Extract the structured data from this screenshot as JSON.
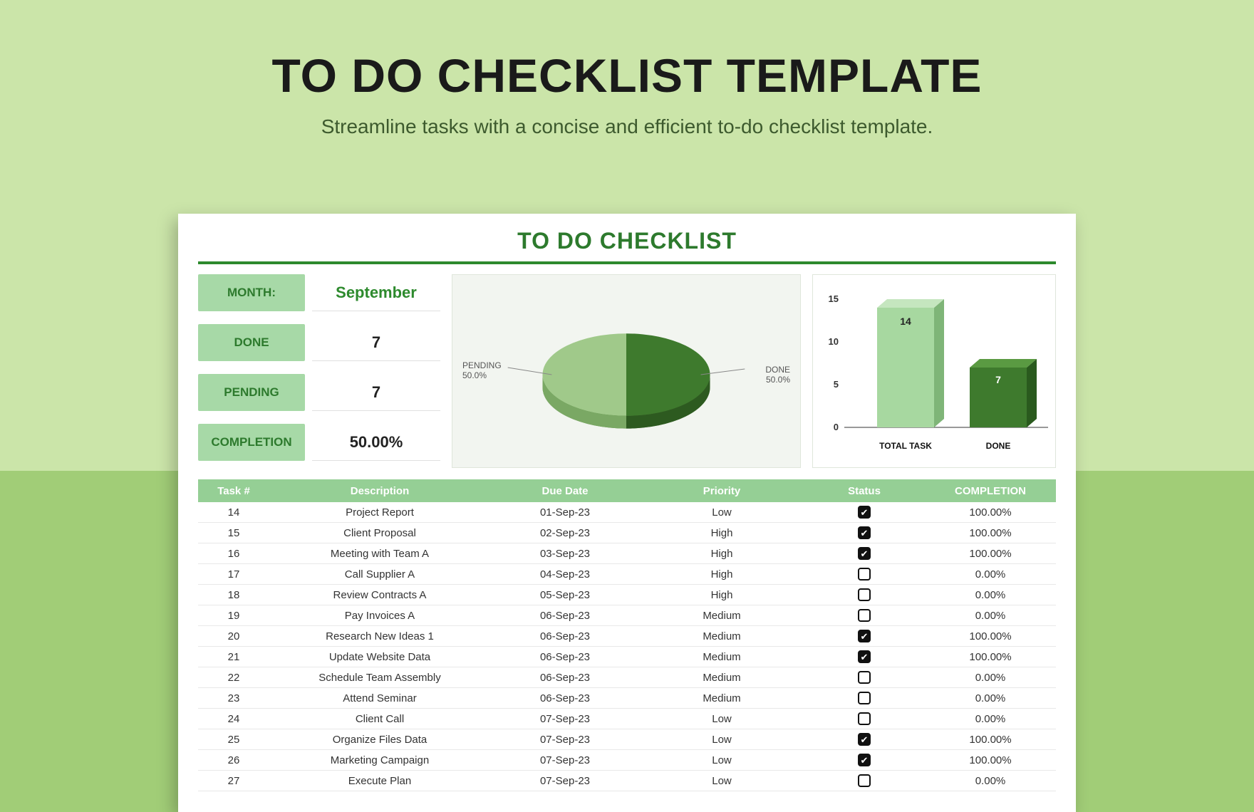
{
  "header": {
    "title": "TO DO CHECKLIST TEMPLATE",
    "subtitle": "Streamline tasks with a concise and efficient to-do checklist template."
  },
  "sheet": {
    "title": "TO DO CHECKLIST",
    "summary": {
      "month_label": "MONTH:",
      "month_value": "September",
      "done_label": "DONE",
      "done_value": "7",
      "pending_label": "PENDING",
      "pending_value": "7",
      "completion_label": "COMPLETION",
      "completion_value": "50.00%"
    },
    "table": {
      "headers": {
        "task": "Task #",
        "desc": "Description",
        "date": "Due Date",
        "prio": "Priority",
        "stat": "Status",
        "comp": "COMPLETION"
      },
      "rows": [
        {
          "task": "14",
          "desc": "Project Report",
          "date": "01-Sep-23",
          "prio": "Low",
          "done": true,
          "comp": "100.00%"
        },
        {
          "task": "15",
          "desc": "Client Proposal",
          "date": "02-Sep-23",
          "prio": "High",
          "done": true,
          "comp": "100.00%"
        },
        {
          "task": "16",
          "desc": "Meeting with Team A",
          "date": "03-Sep-23",
          "prio": "High",
          "done": true,
          "comp": "100.00%"
        },
        {
          "task": "17",
          "desc": "Call Supplier A",
          "date": "04-Sep-23",
          "prio": "High",
          "done": false,
          "comp": "0.00%"
        },
        {
          "task": "18",
          "desc": "Review Contracts A",
          "date": "05-Sep-23",
          "prio": "High",
          "done": false,
          "comp": "0.00%"
        },
        {
          "task": "19",
          "desc": "Pay Invoices A",
          "date": "06-Sep-23",
          "prio": "Medium",
          "done": false,
          "comp": "0.00%"
        },
        {
          "task": "20",
          "desc": "Research New Ideas 1",
          "date": "06-Sep-23",
          "prio": "Medium",
          "done": true,
          "comp": "100.00%"
        },
        {
          "task": "21",
          "desc": "Update Website Data",
          "date": "06-Sep-23",
          "prio": "Medium",
          "done": true,
          "comp": "100.00%"
        },
        {
          "task": "22",
          "desc": "Schedule Team Assembly",
          "date": "06-Sep-23",
          "prio": "Medium",
          "done": false,
          "comp": "0.00%"
        },
        {
          "task": "23",
          "desc": "Attend Seminar",
          "date": "06-Sep-23",
          "prio": "Medium",
          "done": false,
          "comp": "0.00%"
        },
        {
          "task": "24",
          "desc": "Client Call",
          "date": "07-Sep-23",
          "prio": "Low",
          "done": false,
          "comp": "0.00%"
        },
        {
          "task": "25",
          "desc": "Organize Files Data",
          "date": "07-Sep-23",
          "prio": "Low",
          "done": true,
          "comp": "100.00%"
        },
        {
          "task": "26",
          "desc": "Marketing Campaign",
          "date": "07-Sep-23",
          "prio": "Low",
          "done": true,
          "comp": "100.00%"
        },
        {
          "task": "27",
          "desc": "Execute Plan",
          "date": "07-Sep-23",
          "prio": "Low",
          "done": false,
          "comp": "0.00%"
        }
      ]
    }
  },
  "chart_data": [
    {
      "type": "pie",
      "title": "",
      "series": [
        {
          "name": "PENDING",
          "value": 50.0,
          "label": "50.0%",
          "color": "#a0c98a"
        },
        {
          "name": "DONE",
          "value": 50.0,
          "label": "50.0%",
          "color": "#3e7a2d"
        }
      ]
    },
    {
      "type": "bar",
      "categories": [
        "TOTAL TASK",
        "DONE"
      ],
      "values": [
        14,
        7
      ],
      "ylim": [
        0,
        15
      ],
      "yticks": [
        0,
        5,
        10,
        15
      ],
      "colors": [
        "#a7d8a0",
        "#3e7a2d"
      ],
      "data_labels": [
        "14",
        "7"
      ]
    }
  ]
}
